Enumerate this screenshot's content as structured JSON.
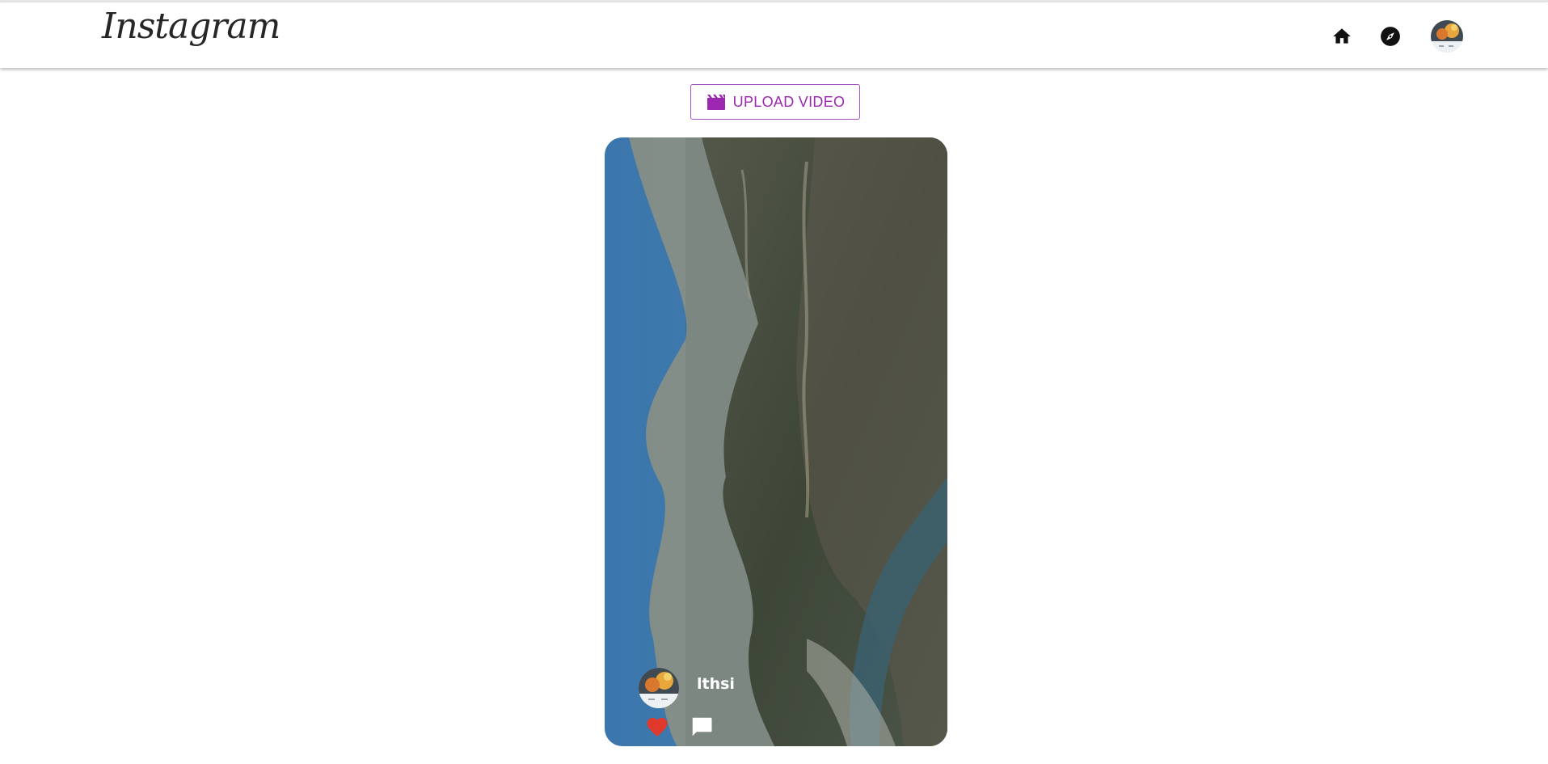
{
  "header": {
    "logo_text": "Instagram",
    "nav": {
      "home_icon": "home-icon",
      "explore_icon": "compass-icon",
      "profile_icon": "avatar"
    }
  },
  "upload": {
    "label": "UPLOAD VIDEO",
    "icon": "movie-clapper-icon",
    "color": "#9c27b0"
  },
  "post": {
    "username": "lthsi",
    "like_icon": "heart-icon",
    "like_color": "#e0392b",
    "comment_icon": "comment-icon"
  }
}
